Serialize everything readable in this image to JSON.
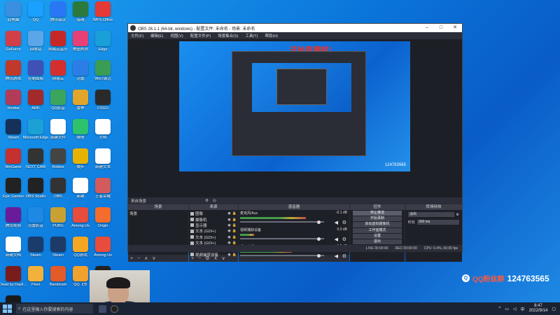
{
  "desktop": {
    "icons": [
      {
        "label": "此电脑",
        "color": "#3b8fe0"
      },
      {
        "label": "QQ",
        "color": "#1aa0ff"
      },
      {
        "label": "腾讯会议",
        "color": "#2a77f5"
      },
      {
        "label": "猎魂",
        "color": "#2b7a3c"
      },
      {
        "label": "WPS Office",
        "color": "#e53935"
      },
      {
        "label": "GeForce",
        "color": "#d23f49"
      },
      {
        "label": "回收站",
        "color": "#5aa6e8"
      },
      {
        "label": "网易云音乐",
        "color": "#c62828"
      },
      {
        "label": "美图秀秀",
        "color": "#e83f77"
      },
      {
        "label": "Edge",
        "color": "#19a0d8"
      },
      {
        "label": "腾讯游戏",
        "color": "#c0392b"
      },
      {
        "label": "控制面板",
        "color": "#3f51b5"
      },
      {
        "label": "网易云",
        "color": "#d32f2f"
      },
      {
        "label": "迅雷",
        "color": "#2d7de6"
      },
      {
        "label": "Win7激活",
        "color": "#3b9c55"
      },
      {
        "label": "Honkai",
        "color": "#b23b58"
      },
      {
        "label": "ARK",
        "color": "#a32a2a"
      },
      {
        "label": "QQ影音",
        "color": "#3ba55d"
      },
      {
        "label": "雷神",
        "color": "#e0a52a"
      },
      {
        "label": "CSGO",
        "color": "#2a2a2a"
      },
      {
        "label": "Steam",
        "color": "#15315a"
      },
      {
        "label": "Microsoft Edge",
        "color": "#1ba1d6"
      },
      {
        "label": "新建文件",
        "color": "#ffffff"
      },
      {
        "label": "微信",
        "color": "#2dc26b"
      },
      {
        "label": "文档",
        "color": "#ffffff"
      },
      {
        "label": "WeGame",
        "color": "#c53030"
      },
      {
        "label": "NZXT CAM",
        "color": "#333333"
      },
      {
        "label": "Roblox",
        "color": "#444444"
      },
      {
        "label": "微步",
        "color": "#e6b200"
      },
      {
        "label": "新建文本",
        "color": "#ffffff"
      },
      {
        "label": "Epic Games",
        "color": "#222222"
      },
      {
        "label": "OBS Studio",
        "color": "#222222"
      },
      {
        "label": "OBS",
        "color": "#333333"
      },
      {
        "label": "新建",
        "color": "#ffffff"
      },
      {
        "label": "王者荣耀",
        "color": "#d35b5b"
      },
      {
        "label": "腾讯视频",
        "color": "#6a1b9a"
      },
      {
        "label": "迅雷影音",
        "color": "#1e88e5"
      },
      {
        "label": "PUBG",
        "color": "#c9a133"
      },
      {
        "label": "Among Us",
        "color": "#e74c3c"
      },
      {
        "label": "Origin",
        "color": "#f56c2d"
      },
      {
        "label": "新建文档",
        "color": "#ffffff"
      },
      {
        "label": "Steam",
        "color": "#1b3b6a"
      },
      {
        "label": "Steam",
        "color": "#1d3b66"
      },
      {
        "label": "QQ游戏",
        "color": "#f5a623"
      },
      {
        "label": "Among Us",
        "color": "#e74c3c"
      },
      {
        "label": "Dead by Daylight",
        "color": "#7a1c1c"
      },
      {
        "label": "Pixel",
        "color": "#f2b13b"
      },
      {
        "label": "Bandicam",
        "color": "#e35a2b"
      },
      {
        "label": "QQ飞车",
        "color": "#f2a12c"
      },
      {
        "label": "Mw",
        "color": "#222222"
      },
      {
        "label": "ARK",
        "color": "#1a1a1a"
      }
    ]
  },
  "obs": {
    "title": "OBS 26.1.1 (64-bit, windows) - 配置文件: 未命名 - 场景: 未命名",
    "menu": [
      "文件(F)",
      "编辑(E)",
      "视图(V)",
      "配置文件(P)",
      "场景集合(S)",
      "工具(T)",
      "帮助(H)"
    ],
    "overlay_text": "开始直播啦！",
    "preview_qq": "124763565",
    "scene_bar": {
      "label": "来自场景"
    },
    "docks": {
      "scenes": {
        "title": "场景",
        "items": [
          "场景"
        ]
      },
      "sources": {
        "title": "来源",
        "items": [
          "图像",
          "摄像机",
          "显示器",
          "文本 (GDI+)",
          "文本 (GDI+)",
          "文本 (GDI+)",
          "文本 (GDI+)",
          "视频捕获设备"
        ]
      },
      "mixer": {
        "title": "混音器",
        "channels": [
          {
            "name": "麦克风/Aux",
            "db": "-0.1 dB",
            "level": 0.62
          },
          {
            "name": "视频捕获设备",
            "db": "0.0 dB",
            "level": 0.0
          },
          {
            "name": "桌面音频",
            "db": "-1.0 dB",
            "level": 0.45
          }
        ]
      },
      "controls": {
        "title": "控件",
        "buttons": [
          "停止推流",
          "开始录制",
          "启动虚拟摄像机",
          "工作室模式",
          "设置",
          "退出"
        ]
      },
      "transitions": {
        "title": "转场特效",
        "type": "淡出",
        "duration_label": "时长",
        "duration_value": "300 ms"
      }
    },
    "status": [
      "LIVE 00:00:00",
      "REC 00:00:00",
      "CPU: 0.4%, 60.00 fps"
    ]
  },
  "qq_overlay": {
    "label": "QQ粉丝群",
    "number": "124763565"
  },
  "taskbar": {
    "search_placeholder": "在这里输入你要搜索的内容",
    "time": "8:47",
    "date": "2022/9/14"
  }
}
